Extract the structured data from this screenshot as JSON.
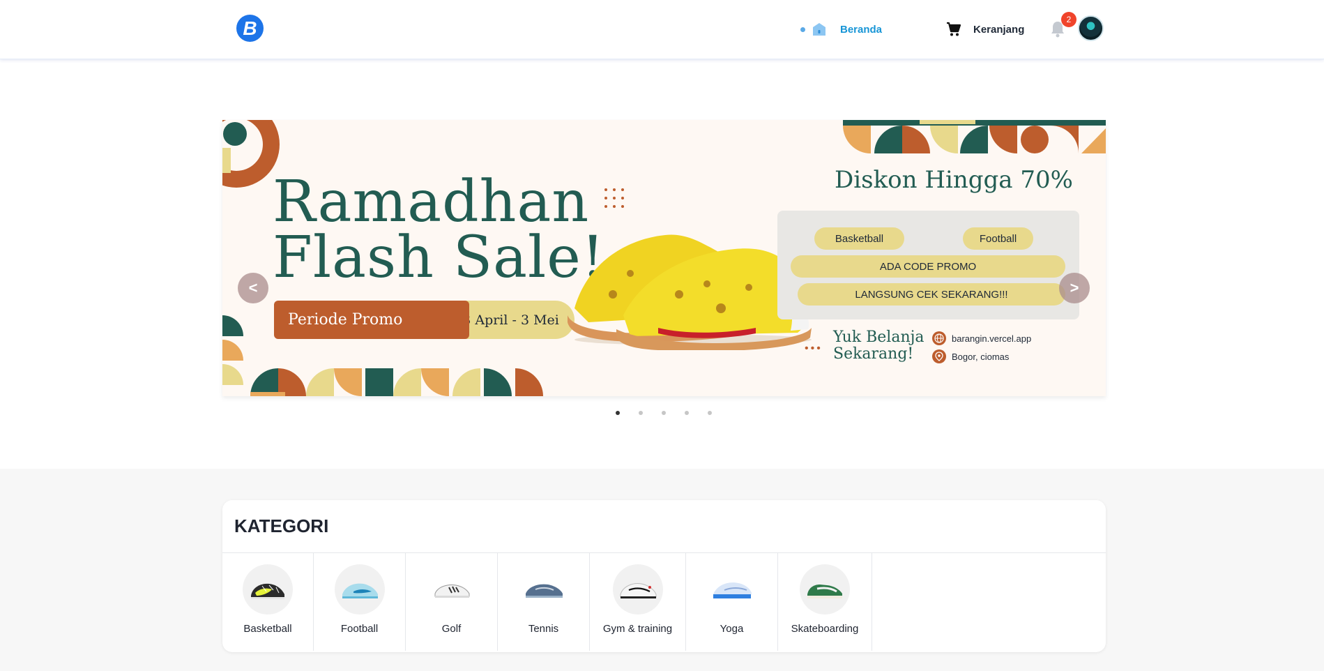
{
  "header": {
    "logo_letter": "B",
    "nav_home": "Beranda",
    "nav_cart": "Keranjang",
    "notification_count": "2"
  },
  "banner": {
    "title_line1": "Ramadhan",
    "title_line2": "Flash Sale!",
    "periode_label": "Periode Promo",
    "periode_dates": "23 April - 3 Mei",
    "discount_text": "Diskon Hingga 70%",
    "tag1": "Basketball",
    "tag2": "Football",
    "promo_code_text": "ADA CODE PROMO",
    "cta_text": "LANGSUNG CEK SEKARANG!!!",
    "slogan_line1": "Yuk Belanja",
    "slogan_line2": "Sekarang!",
    "website": "barangin.vercel.app",
    "location": "Bogor, ciomas",
    "colors": {
      "teal": "#225c52",
      "rust": "#bd5d2d",
      "sand": "#e8d98c",
      "peach": "#e9a85b"
    }
  },
  "carousel": {
    "prev_label": "<",
    "next_label": ">",
    "slide_count": 5,
    "active_slide": 1
  },
  "categories": {
    "title": "KATEGORI",
    "items": [
      {
        "label": "Basketball"
      },
      {
        "label": "Football"
      },
      {
        "label": "Golf"
      },
      {
        "label": "Tennis"
      },
      {
        "label": "Gym & training"
      },
      {
        "label": "Yoga"
      },
      {
        "label": "Skateboarding"
      }
    ]
  }
}
